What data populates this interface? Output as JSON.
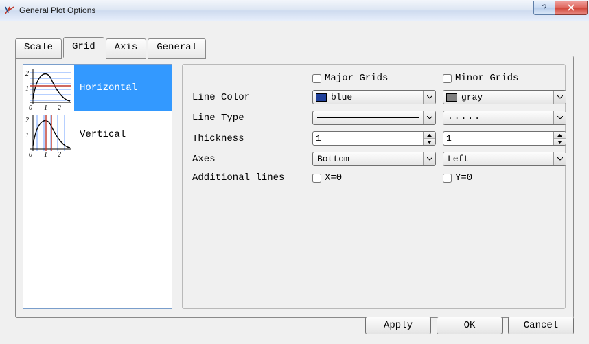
{
  "window": {
    "title": "General Plot Options"
  },
  "tabs": [
    "Scale",
    "Grid",
    "Axis",
    "General"
  ],
  "active_tab": "Grid",
  "sidelist": {
    "items": [
      {
        "label": "Horizontal",
        "selected": true
      },
      {
        "label": "Vertical",
        "selected": false
      }
    ]
  },
  "grid_opts": {
    "headers": {
      "major": "Major Grids",
      "minor": "Minor Grids"
    },
    "rows": {
      "line_color": {
        "label": "Line Color",
        "major": {
          "text": "blue",
          "swatch": "#20409a"
        },
        "minor": {
          "text": "gray",
          "swatch": "#808080"
        }
      },
      "line_type": {
        "label": "Line Type",
        "major": "solid",
        "minor": "dotted",
        "dotted_glyph": "....."
      },
      "thickness": {
        "label": "Thickness",
        "major": "1",
        "minor": "1"
      },
      "axes": {
        "label": "Axes",
        "major": "Bottom",
        "minor": "Left"
      },
      "additional": {
        "label": "Additional lines",
        "major": "X=0",
        "minor": "Y=0"
      }
    }
  },
  "buttons": {
    "apply": "Apply",
    "ok": "OK",
    "cancel": "Cancel"
  }
}
